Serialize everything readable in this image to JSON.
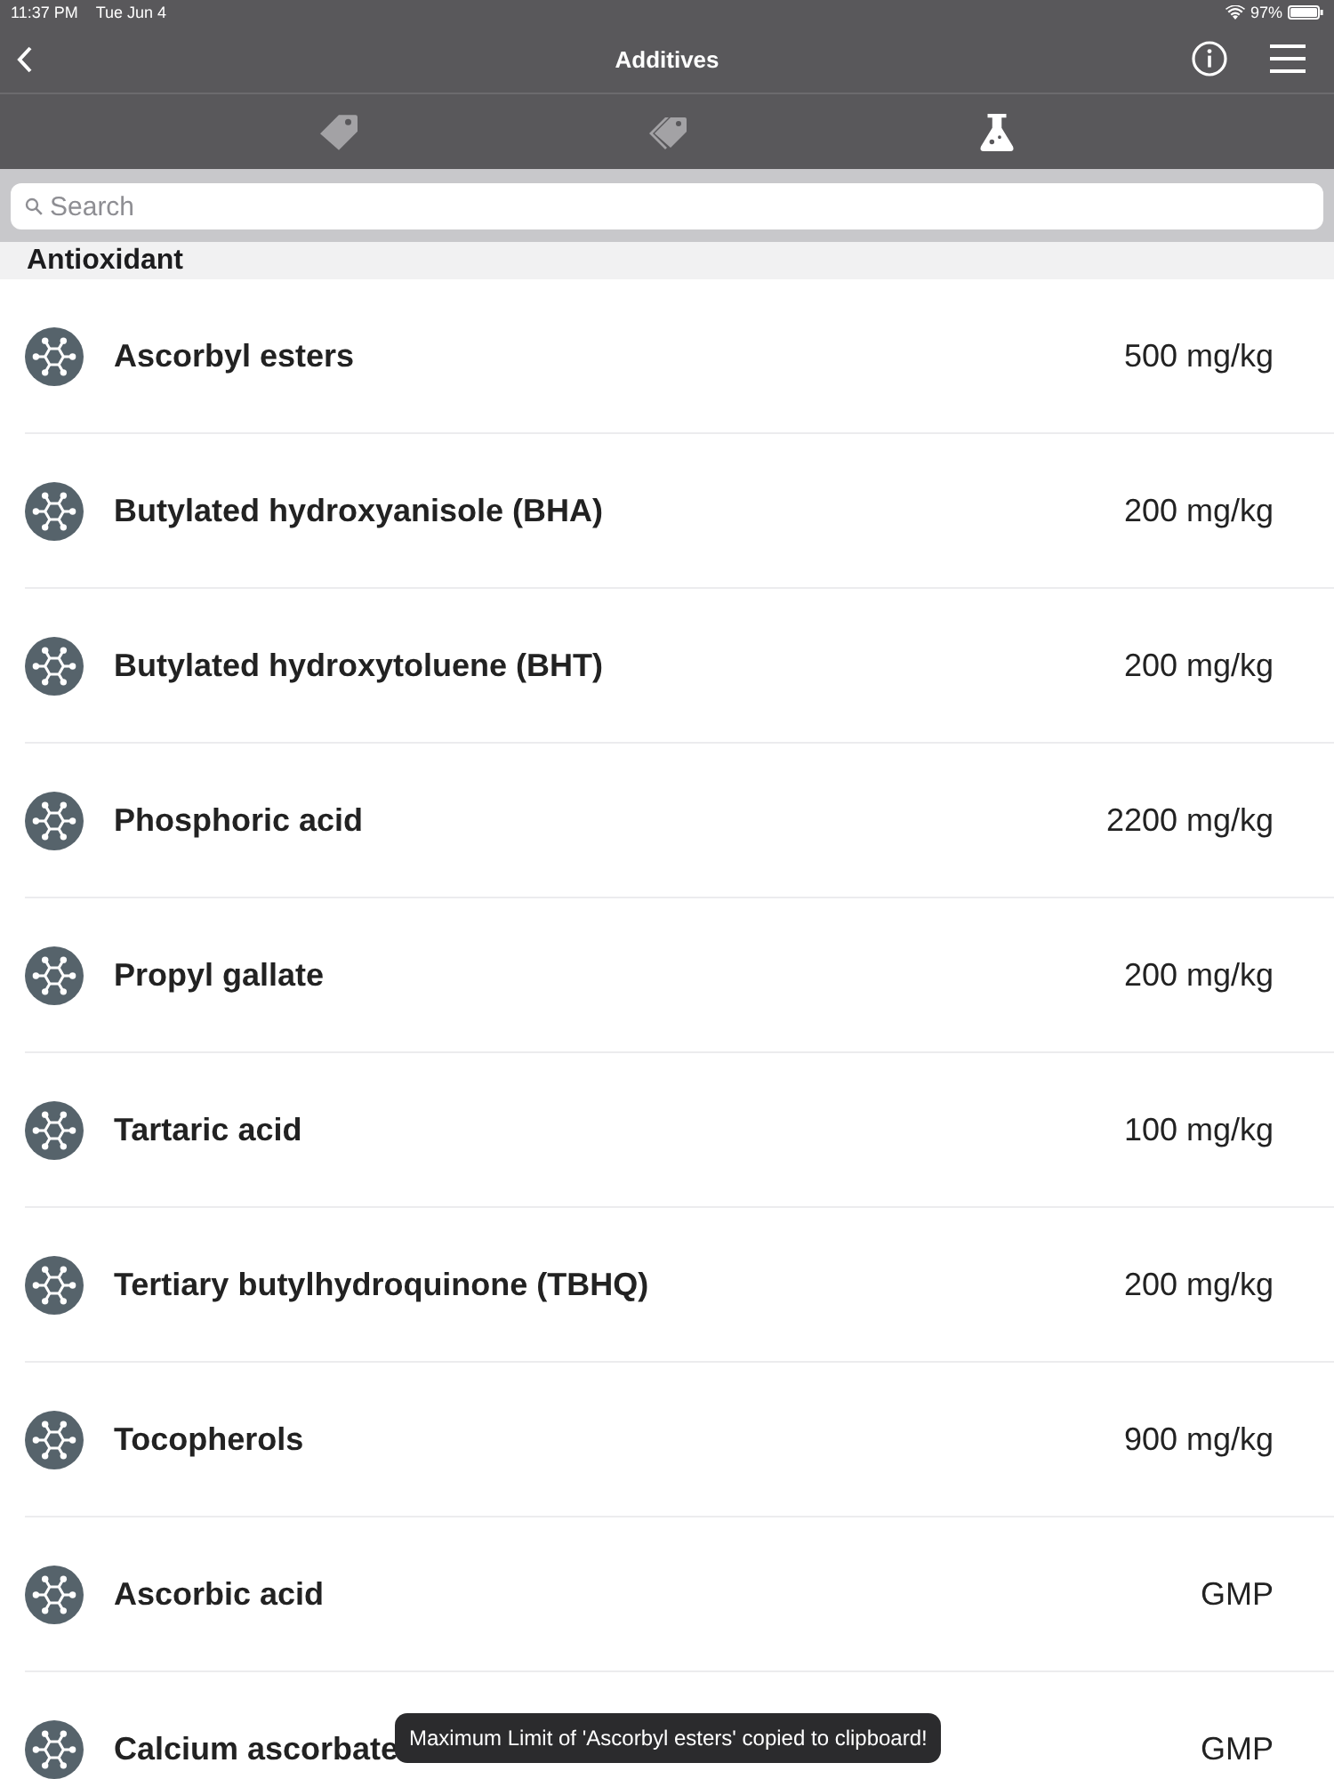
{
  "status_bar": {
    "time": "11:37 PM",
    "date": "Tue Jun 4",
    "battery": "97%"
  },
  "nav_bar": {
    "title": "Additives"
  },
  "tabs": [
    {
      "kind": "tag",
      "selected": false
    },
    {
      "kind": "tags",
      "selected": false
    },
    {
      "kind": "flask",
      "selected": true
    }
  ],
  "search": {
    "placeholder": "Search"
  },
  "section": {
    "title": "Antioxidant",
    "items": [
      {
        "name": "Ascorbyl esters",
        "limit": "500 mg/kg"
      },
      {
        "name": "Butylated hydroxyanisole (BHA)",
        "limit": "200 mg/kg"
      },
      {
        "name": "Butylated hydroxytoluene (BHT)",
        "limit": "200 mg/kg"
      },
      {
        "name": "Phosphoric acid",
        "limit": "2200 mg/kg"
      },
      {
        "name": "Propyl gallate",
        "limit": "200 mg/kg"
      },
      {
        "name": "Tartaric acid",
        "limit": "100 mg/kg"
      },
      {
        "name": "Tertiary butylhydroquinone (TBHQ)",
        "limit": "200 mg/kg"
      },
      {
        "name": "Tocopherols",
        "limit": "900 mg/kg"
      },
      {
        "name": "Ascorbic acid",
        "limit": "GMP"
      },
      {
        "name": "Calcium ascorbate",
        "limit": "GMP"
      }
    ]
  },
  "toast": {
    "text": "Maximum Limit of 'Ascorbyl esters' copied to clipboard!"
  }
}
